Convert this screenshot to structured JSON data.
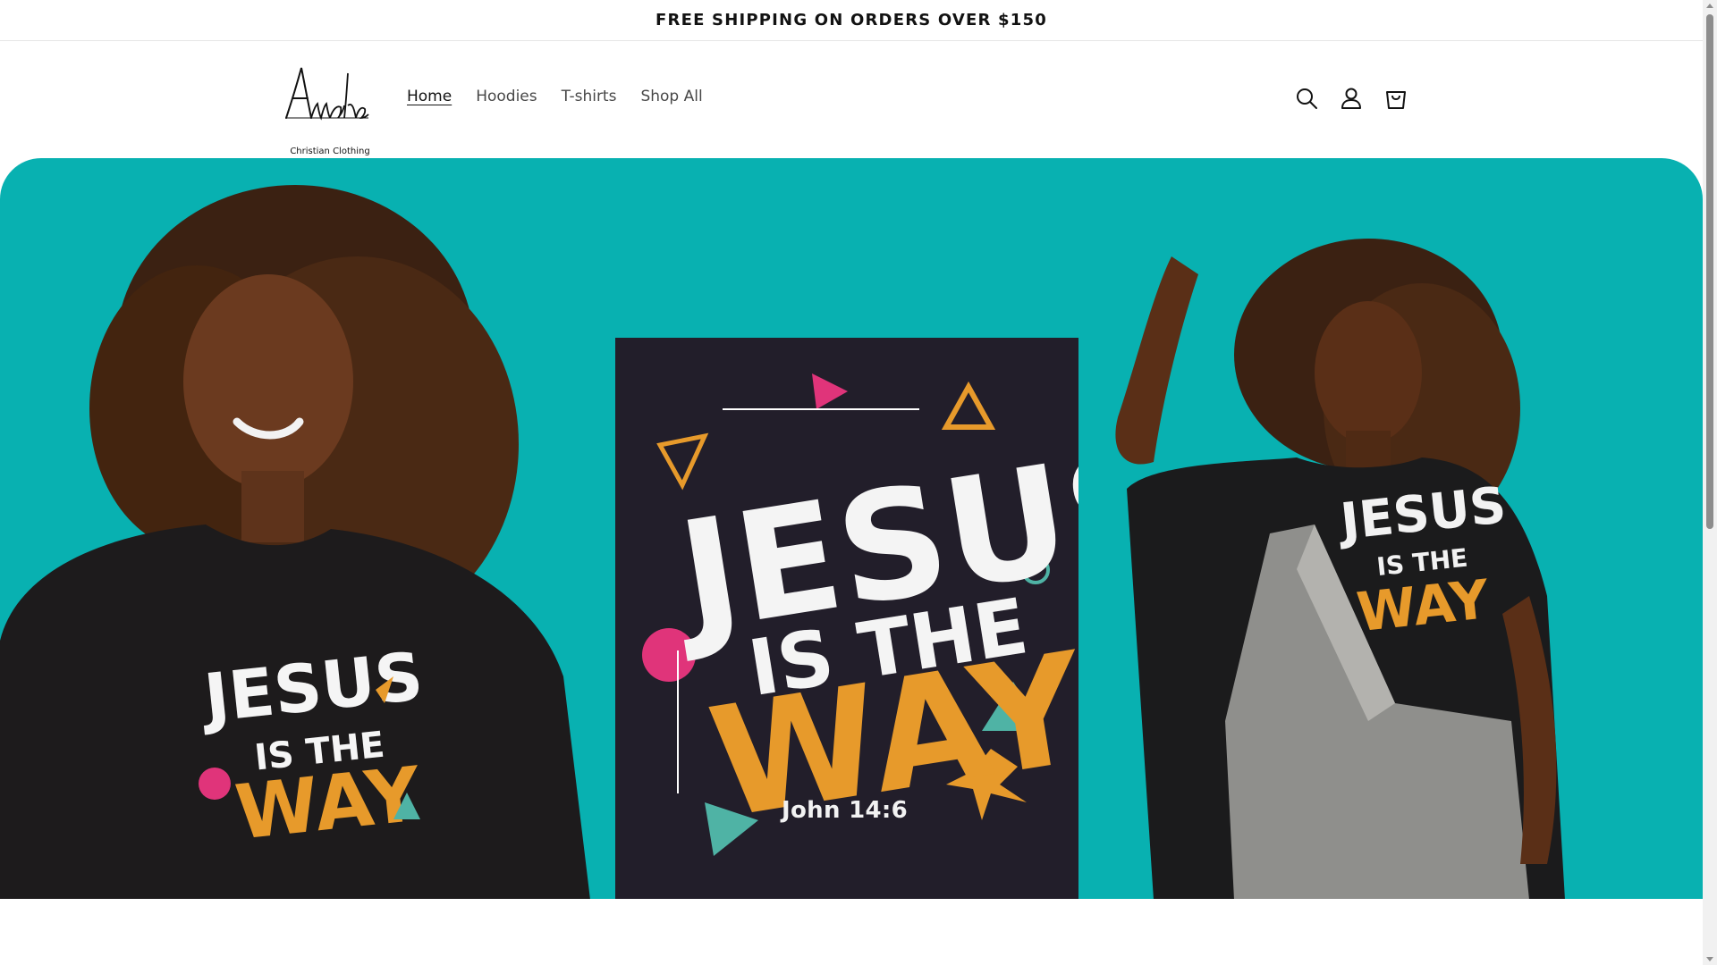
{
  "announcement": {
    "text": "FREE SHIPPING ON ORDERS OVER $150"
  },
  "header": {
    "logo": {
      "wordmark": "Awaken",
      "tagline": "Christian Clothing"
    },
    "nav": [
      {
        "label": "Home",
        "active": true
      },
      {
        "label": "Hoodies",
        "active": false
      },
      {
        "label": "T-shirts",
        "active": false
      },
      {
        "label": "Shop All",
        "active": false
      }
    ],
    "icons": [
      "search-icon",
      "account-icon",
      "cart-icon"
    ]
  },
  "hero": {
    "background_color": "#08b1b1",
    "design_lines": [
      "JESUS",
      "IS THE",
      "WAY"
    ],
    "scripture_ref": "John 14:6"
  },
  "colors": {
    "accent_teal": "#08b1b1",
    "design_orange": "#e79a2b",
    "design_pink": "#e0347a",
    "text_dark": "#121212"
  }
}
